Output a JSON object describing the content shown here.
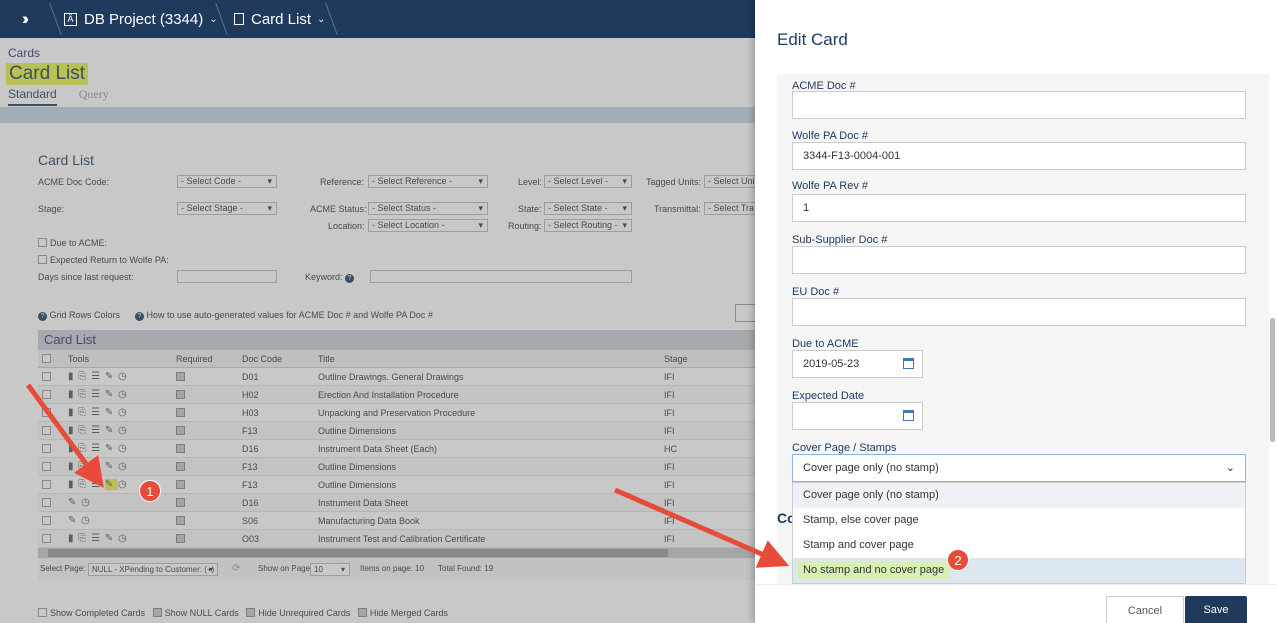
{
  "topbar": {
    "project": "DB Project (3344)",
    "page": "Card List"
  },
  "header": {
    "section": "Cards",
    "title": "Card List"
  },
  "tabs": [
    "Standard",
    "Query"
  ],
  "filters": {
    "title": "Card List",
    "acme_doc_code_label": "ACME Doc Code:",
    "acme_doc_code_value": "- Select Code -",
    "reference_label": "Reference:",
    "reference_value": "- Select Reference -",
    "level_label": "Level:",
    "level_value": "- Select Level -",
    "tagged_units_label": "Tagged Units:",
    "tagged_units_value": "- Select Uni",
    "stage_label": "Stage:",
    "stage_value": "- Select Stage -",
    "acme_status_label": "ACME Status:",
    "acme_status_value": "- Select Status -",
    "state_label": "State:",
    "state_value": "- Select State -",
    "transmittal_label": "Transmittal:",
    "transmittal_value": "- Select Tra",
    "location_label": "Location:",
    "location_value": "- Select Location -",
    "routing_label": "Routing:",
    "routing_value": "- Select Routing -",
    "due_to_acme": "Due to ACME:",
    "expected_return": "Expected Return to Wolfe PA:",
    "days_since": "Days since last request:",
    "keyword": "Keyword:"
  },
  "help": {
    "grid_colors": "Grid Rows Colors",
    "auto_values": "How to use auto-generated values for ACME Doc # and Wolfe PA Doc #"
  },
  "grid": {
    "title": "Card List",
    "columns": [
      "Tools",
      "Required",
      "Doc Code",
      "Title",
      "Stage"
    ],
    "rows": [
      {
        "code": "D01",
        "title": "Outline Drawings. General Drawings",
        "stage": "IFI",
        "tools": "full"
      },
      {
        "code": "H02",
        "title": "Erection And Installation Procedure",
        "stage": "IFI",
        "tools": "full"
      },
      {
        "code": "H03",
        "title": "Unpacking and Preservation Procedure",
        "stage": "IFI",
        "tools": "full"
      },
      {
        "code": "F13",
        "title": "Outline Dimensions",
        "stage": "IFI",
        "tools": "full"
      },
      {
        "code": "D16",
        "title": "Instrument Data Sheet (Each)",
        "stage": "HC",
        "tools": "full"
      },
      {
        "code": "F13",
        "title": "Outline Dimensions",
        "stage": "IFI",
        "tools": "full"
      },
      {
        "code": "F13",
        "title": "Outline Dimensions",
        "stage": "IFI",
        "tools": "full"
      },
      {
        "code": "D16",
        "title": "Instrument Data Sheet",
        "stage": "IFI",
        "tools": "short"
      },
      {
        "code": "S06",
        "title": "Manufacturing Data Book",
        "stage": "IFI",
        "tools": "short"
      },
      {
        "code": "O03",
        "title": "Instrument Test and Calibration Certificate",
        "stage": "IFI",
        "tools": "full"
      }
    ],
    "pager": {
      "select_page_label": "Select Page:",
      "select_page_value": "NULL - XPending to Customer: (+)",
      "show_on_page_label": "Show on Page:",
      "show_on_page_value": "10",
      "items_on_page": "Items on page: 10",
      "total_found": "Total Found: 19"
    },
    "bottom_checks": [
      "Show Completed Cards",
      "Show NULL Cards",
      "Hide Unrequired Cards",
      "Hide Merged Cards"
    ]
  },
  "annotations": {
    "one": "1",
    "two": "2"
  },
  "panel": {
    "title": "Edit Card",
    "acme_doc_label": "ACME Doc #",
    "acme_doc_value": "",
    "wolfe_doc_label": "Wolfe PA Doc #",
    "wolfe_doc_value": "3344-F13-0004-001",
    "wolfe_rev_label": "Wolfe PA Rev #",
    "wolfe_rev_value": "1",
    "sub_supplier_label": "Sub-Supplier Doc #",
    "sub_supplier_value": "",
    "eu_doc_label": "EU Doc #",
    "eu_doc_value": "",
    "due_label": "Due to ACME",
    "due_value": "2019-05-23",
    "expected_label": "Expected Date",
    "expected_value": "",
    "cover_label": "Cover Page / Stamps",
    "cover_value": "Cover page only (no stamp)",
    "cover_options": [
      "Cover page only (no stamp)",
      "Stamp, else cover page",
      "Stamp and cover page",
      "No stamp and no cover page"
    ],
    "behind_text": "Co",
    "cancel": "Cancel",
    "save": "Save"
  },
  "colors": {
    "navy": "#1f3a5c",
    "highlight": "#e6f247",
    "marker": "#e84b3a",
    "option_hover": "#e8f6d4"
  }
}
